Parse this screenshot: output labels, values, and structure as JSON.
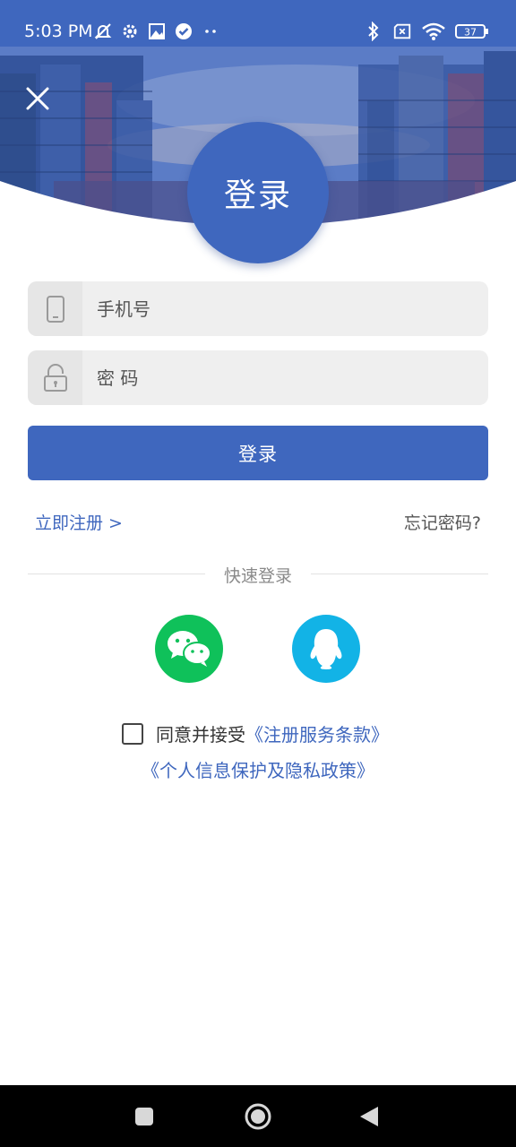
{
  "status_bar": {
    "time": "5:03 PM",
    "battery": "37",
    "icons_left": [
      "mute-icon",
      "gear-icon",
      "photo-icon",
      "check-circle-icon",
      "more-dots-icon"
    ],
    "icons_right": [
      "bluetooth-icon",
      "sim-x-icon",
      "wifi-icon",
      "battery-icon"
    ]
  },
  "header": {
    "circle_title": "登录"
  },
  "form": {
    "phone_placeholder": "手机号",
    "password_placeholder": "密 码",
    "login_button": "登录"
  },
  "links": {
    "register": "立即注册 >",
    "forgot": "忘记密码?"
  },
  "quick_login": {
    "title": "快速登录",
    "providers": [
      "WeChat",
      "QQ"
    ]
  },
  "agreement": {
    "prefix": "同意并接受",
    "terms": "《注册服务条款》",
    "privacy": "《个人信息保护及隐私政策》"
  },
  "colors": {
    "primary": "#3f67be",
    "wechat": "#0fc15a",
    "qq": "#12b3e6"
  }
}
